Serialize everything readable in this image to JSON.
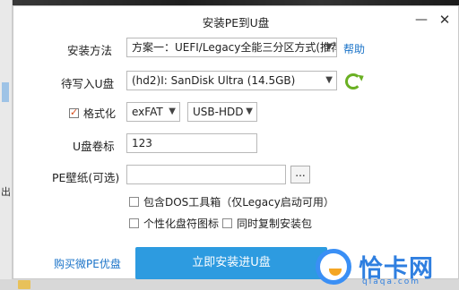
{
  "dialog": {
    "title": "安装PE到U盘",
    "minimize_glyph": "—",
    "close_glyph": "✕"
  },
  "install_method": {
    "label": "安装方法",
    "value": "方案一：UEFI/Legacy全能三分区方式(推荐)",
    "help_link": "帮助"
  },
  "target_disk": {
    "label": "待写入U盘",
    "value": "(hd2)I: SanDisk Ultra (14.5GB)",
    "refresh_icon": "refresh-icon"
  },
  "format": {
    "label": "格式化",
    "checked": true,
    "filesystem": "exFAT",
    "mode": "USB-HDD"
  },
  "volume_label": {
    "label": "U盘卷标",
    "value": "123"
  },
  "wallpaper": {
    "label": "PE壁纸(可选)",
    "value": "",
    "browse_label": "..."
  },
  "options": {
    "dos_tools": "包含DOS工具箱（仅Legacy启动可用）",
    "custom_icon": "个性化盘符图标",
    "copy_installer": "同时复制安装包"
  },
  "footer": {
    "buy_link": "购买微PE优盘",
    "install_button": "立即安装进U盘"
  },
  "background": {
    "left_char": "出"
  },
  "watermark": {
    "text": "恰卡网",
    "sub": "qiaqa.com"
  }
}
